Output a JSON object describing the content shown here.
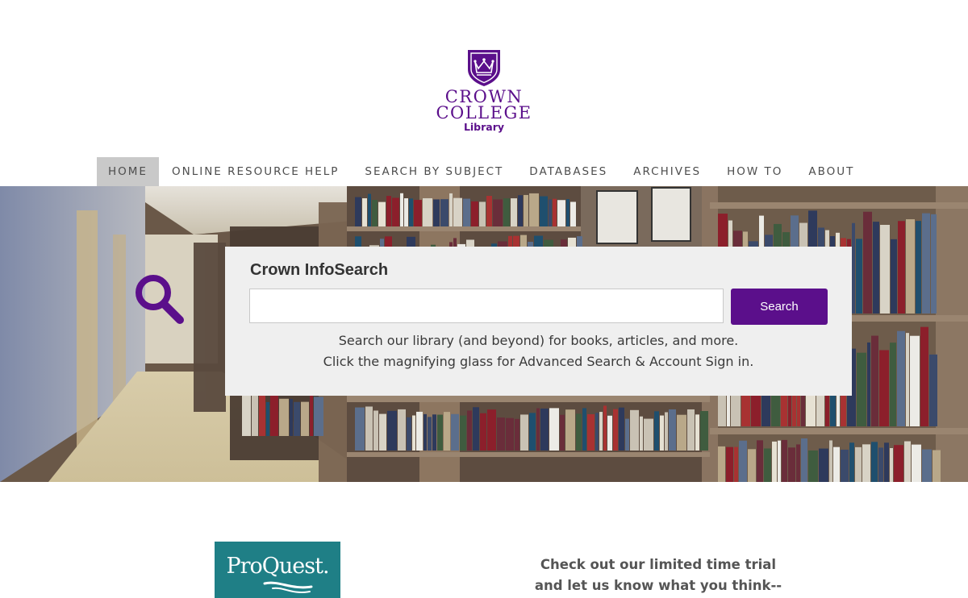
{
  "logo": {
    "name_line1": "CROWN",
    "name_line2": "COLLEGE",
    "sub": "Library",
    "brand_color": "#5b0f8b",
    "icon": "crown-shield-icon"
  },
  "nav": {
    "items": [
      {
        "label": "HOME",
        "active": true
      },
      {
        "label": "ONLINE RESOURCE HELP"
      },
      {
        "label": "SEARCH BY SUBJECT"
      },
      {
        "label": "DATABASES"
      },
      {
        "label": "ARCHIVES"
      },
      {
        "label": "HOW TO"
      },
      {
        "label": "ABOUT"
      }
    ]
  },
  "hero": {
    "background": "library-shelves-photo",
    "magnifier_icon": "magnifying-glass-icon"
  },
  "search": {
    "title": "Crown InfoSearch",
    "value": "",
    "placeholder": "",
    "button_label": "Search",
    "desc_line1": "Search our library (and beyond) for books, articles, and more.",
    "desc_line2": "Click the magnifying glass for Advanced Search & Account Sign in."
  },
  "promo": {
    "logo_text": "ProQuest.",
    "trial_line1": "Check out our limited time trial",
    "trial_line2": "and let us know what you think--"
  },
  "colors": {
    "accent": "#5b0f8b",
    "nav_active_bg": "#c9c9c9",
    "panel_bg": "#efefef",
    "proquest_teal": "#1f7f86"
  }
}
